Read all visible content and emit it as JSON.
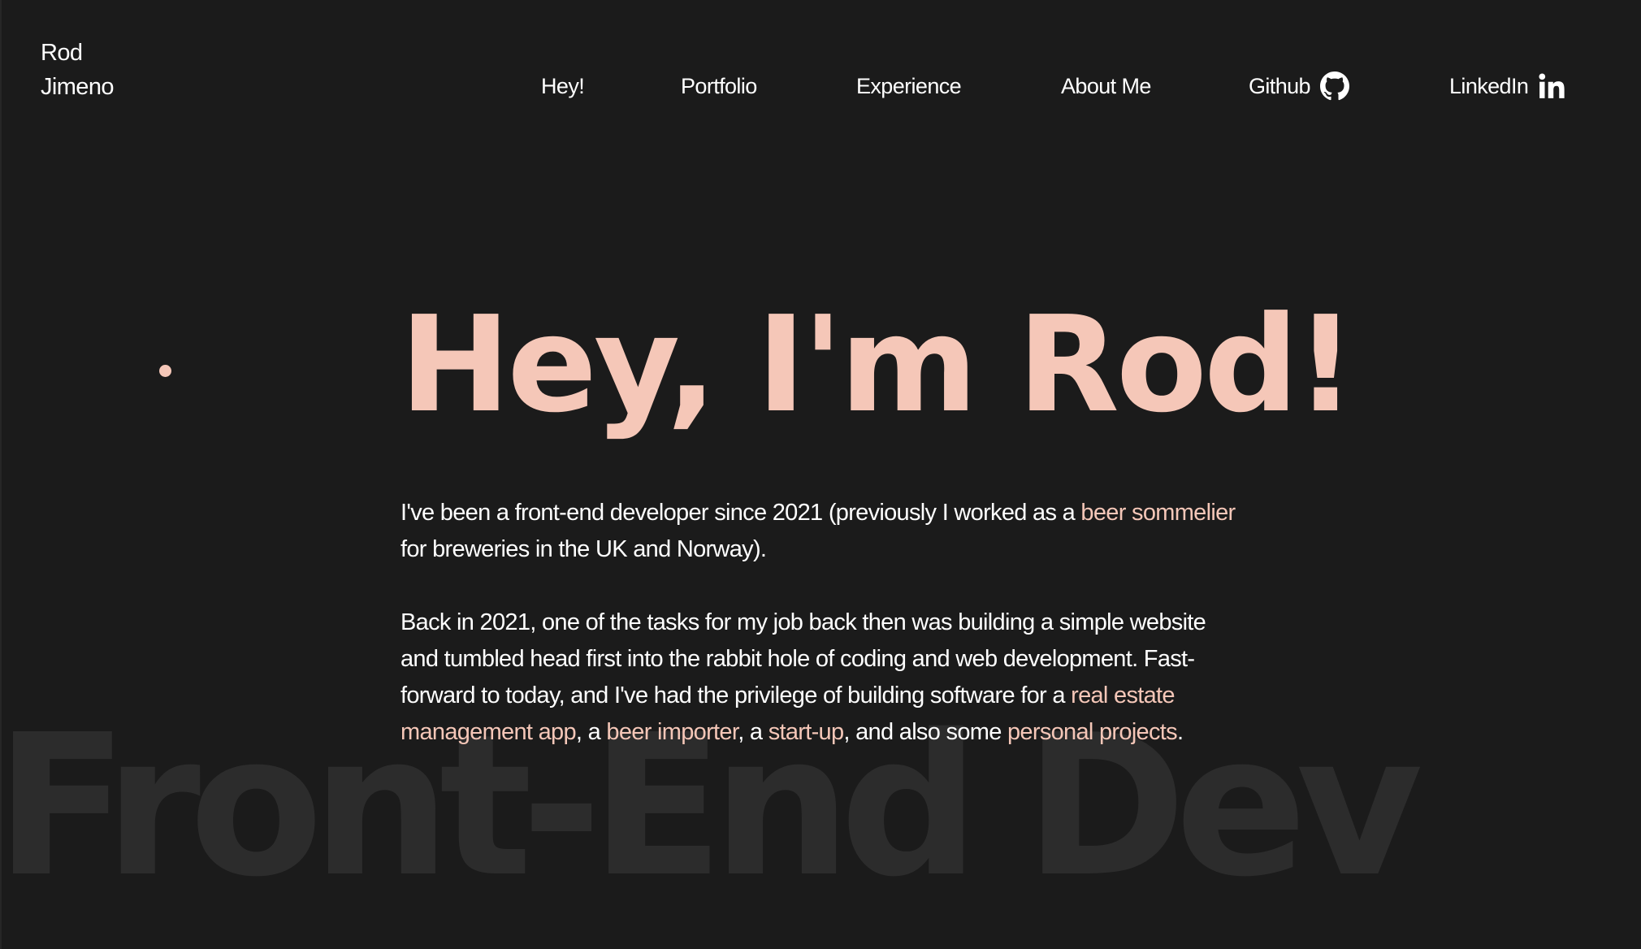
{
  "brand": {
    "first_name": "Rod",
    "last_name": "Jimeno"
  },
  "nav": {
    "hey": "Hey!",
    "portfolio": "Portfolio",
    "experience": "Experience",
    "about": "About Me",
    "github": "Github",
    "github_icon": "github-icon",
    "linkedin": "LinkedIn",
    "linkedin_icon": "linkedin-icon"
  },
  "hero": {
    "title": "Hey, I'm Rod!",
    "background_word": "Front-End Dev"
  },
  "bio": {
    "p1": {
      "t1": "I've been a front-end developer since 2021 (previously I worked as a ",
      "link_beer_sommelier": "beer sommelier",
      "t2": " for breweries in the UK and Norway)."
    },
    "p2": {
      "t1": "Back in 2021, one of the tasks for my job back then was building a simple website and tumbled head first into the rabbit hole of coding and web development. Fast-forward to today, and I've had the privilege of building software for a ",
      "link_real_estate": "real estate management app",
      "t2": ", a ",
      "link_beer_importer": "beer importer",
      "t3": ", a ",
      "link_startup": "start-up",
      "t4": ", and also some ",
      "link_personal_projects": "personal projects",
      "t5": "."
    }
  },
  "colors": {
    "background": "#1b1b1b",
    "accent": "#f5c7b8",
    "text": "#ffffff",
    "watermark": "#2c2c2c"
  }
}
